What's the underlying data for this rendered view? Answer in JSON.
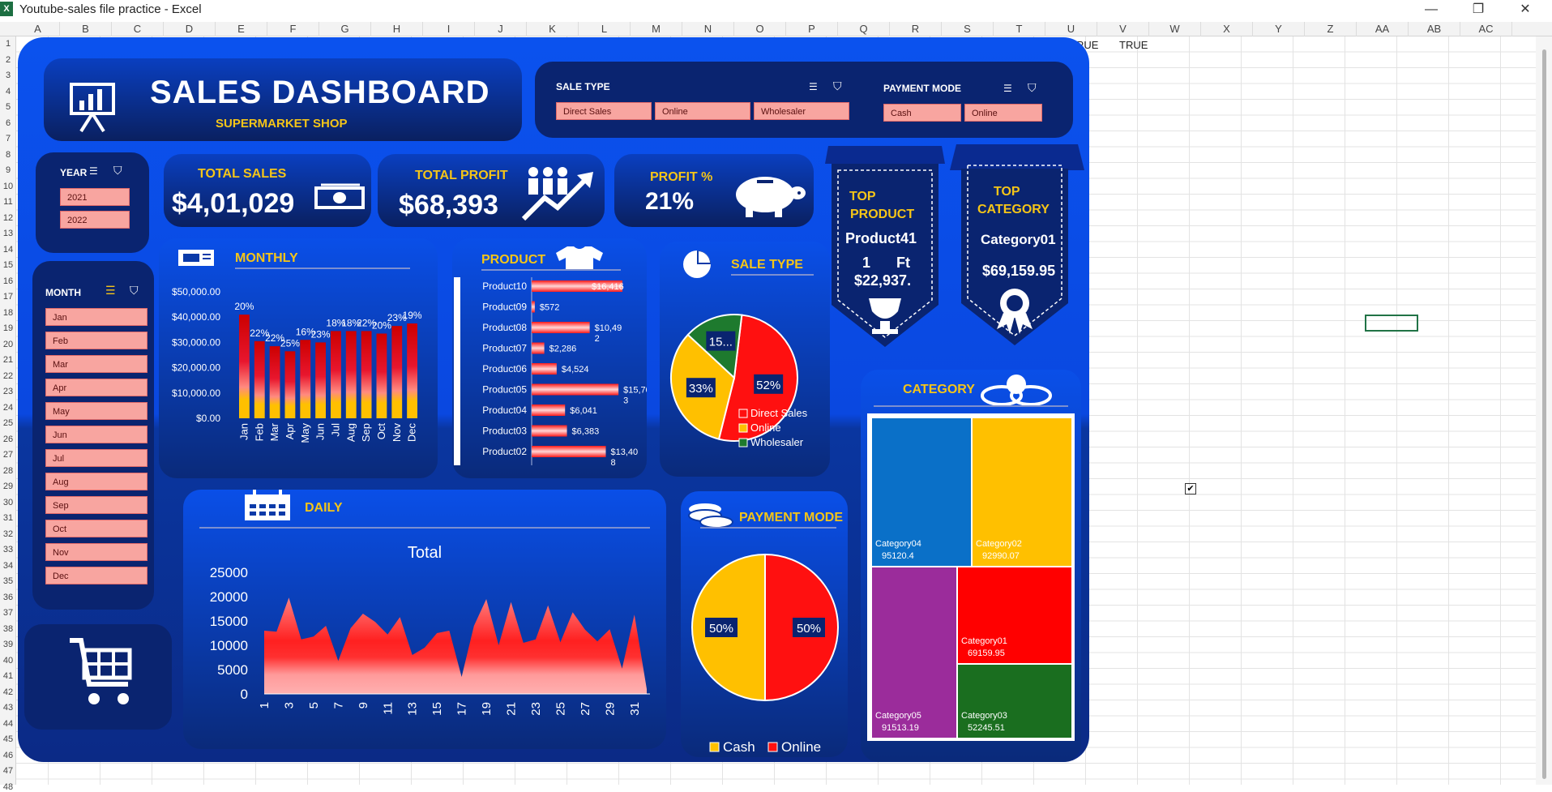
{
  "window": {
    "title": "Youtube-sales file practice - Excel",
    "min": "—",
    "restore": "❐",
    "close": "✕",
    "app_icon": "X"
  },
  "columns": [
    "A",
    "B",
    "C",
    "D",
    "E",
    "F",
    "G",
    "H",
    "I",
    "J",
    "K",
    "L",
    "M",
    "N",
    "O",
    "P",
    "Q",
    "R",
    "S",
    "T",
    "U",
    "V",
    "W",
    "X",
    "Y",
    "Z",
    "AA",
    "AB",
    "AC"
  ],
  "rows": [
    "1",
    "2",
    "3",
    "4",
    "5",
    "6",
    "7",
    "8",
    "9",
    "10",
    "11",
    "12",
    "13",
    "14",
    "15",
    "16",
    "17",
    "18",
    "19",
    "20",
    "21",
    "22",
    "23",
    "24",
    "25",
    "26",
    "27",
    "28",
    "29",
    "30",
    "31",
    "32",
    "33",
    "34",
    "35",
    "36",
    "37",
    "38",
    "39",
    "40",
    "41",
    "42",
    "43",
    "44",
    "45",
    "46",
    "47",
    "48"
  ],
  "cells": {
    "u1": "TRUE",
    "v1": "TRUE",
    "checkbox": "✔"
  },
  "header": {
    "title": "SALES DASHBOARD",
    "subtitle": "SUPERMARKET SHOP"
  },
  "sale_type_slicer": {
    "label": "SALE TYPE",
    "options": [
      "Direct Sales",
      "Online",
      "Wholesaler"
    ]
  },
  "payment_slicer": {
    "label": "PAYMENT MODE",
    "options": [
      "Cash",
      "Online"
    ]
  },
  "year_slicer": {
    "label": "YEAR",
    "options": [
      "2021",
      "2022"
    ]
  },
  "month_slicer": {
    "label": "MONTH",
    "options": [
      "Jan",
      "Feb",
      "Mar",
      "Apr",
      "May",
      "Jun",
      "Jul",
      "Aug",
      "Sep",
      "Oct",
      "Nov",
      "Dec"
    ]
  },
  "kpis": {
    "sales": {
      "title": "TOTAL SALES",
      "value": "$4,01,029"
    },
    "profit": {
      "title": "TOTAL PROFIT",
      "value": "$68,393"
    },
    "profit_pct": {
      "title": "PROFIT %",
      "value": "21%"
    }
  },
  "top_product": {
    "title1": "TOP",
    "title2": "PRODUCT",
    "name": "Product41",
    "line1a": "1",
    "line1b": "Ft",
    "amount": "$22,937."
  },
  "top_category": {
    "title1": "TOP",
    "title2": "CATEGORY",
    "name": "Category01",
    "amount": "$69,159.95"
  },
  "monthly": {
    "title": "MONTHLY"
  },
  "product": {
    "title": "PRODUCT"
  },
  "sale_type": {
    "title": "SALE TYPE"
  },
  "category": {
    "title": "CATEGORY"
  },
  "daily": {
    "title": "DAILY"
  },
  "payment": {
    "title": "PAYMENT MODE"
  },
  "chart_data": [
    {
      "type": "bar",
      "id": "monthly",
      "categories": [
        "Jan",
        "Feb",
        "Mar",
        "Apr",
        "May",
        "Jun",
        "Jul",
        "Aug",
        "Sep",
        "Oct",
        "Nov",
        "Dec"
      ],
      "values": [
        41000,
        30500,
        28500,
        26500,
        31000,
        30000,
        34500,
        34500,
        34500,
        33500,
        36500,
        37500
      ],
      "labels": [
        "20%",
        "22%",
        "22%",
        "25%",
        "16%",
        "23%",
        "18%",
        "18%",
        "22%",
        "20%",
        "23%",
        "19%"
      ],
      "yticks": [
        "$50,000.00",
        "$40,000.00",
        "$30,000.00",
        "$20,000.00",
        "$10,000.00",
        "$0.00"
      ],
      "ylim": [
        0,
        50000
      ]
    },
    {
      "type": "bar",
      "id": "product",
      "orientation": "horizontal",
      "categories": [
        "Product10",
        "Product09",
        "Product08",
        "Product07",
        "Product06",
        "Product05",
        "Product04",
        "Product03",
        "Product02"
      ],
      "values": [
        16416,
        572,
        10492,
        2286,
        4524,
        15703,
        6041,
        6383,
        13408
      ],
      "labels": [
        "$16,416",
        "$572",
        "$10,49\n2",
        "$2,286",
        "$4,524",
        "$15,70\n3",
        "$6,041",
        "$6,383",
        "$13,40\n8"
      ]
    },
    {
      "type": "pie",
      "id": "sale_type",
      "categories": [
        "Direct Sales",
        "Online",
        "Wholesaler"
      ],
      "values": [
        52,
        33,
        15
      ],
      "labels": [
        "52%",
        "33%",
        "15..."
      ],
      "colors": [
        "#ff1010",
        "#ffc000",
        "#1e7a2e"
      ]
    },
    {
      "type": "area",
      "id": "daily",
      "title": "Total",
      "x": [
        1,
        2,
        3,
        4,
        5,
        6,
        7,
        8,
        9,
        10,
        11,
        12,
        13,
        14,
        15,
        16,
        17,
        18,
        19,
        20,
        21,
        22,
        23,
        24,
        25,
        26,
        27,
        28,
        29,
        30,
        31
      ],
      "values": [
        13000,
        12800,
        19800,
        11200,
        11800,
        14000,
        6800,
        13500,
        16500,
        14800,
        12200,
        15800,
        8000,
        9500,
        12500,
        13000,
        3500,
        14000,
        19500,
        10000,
        18900,
        10500,
        11200,
        18200,
        10600,
        16800,
        13200,
        10800,
        13300,
        5200,
        16300,
        1000
      ],
      "xticks": [
        "1",
        "3",
        "5",
        "7",
        "9",
        "11",
        "13",
        "15",
        "17",
        "19",
        "21",
        "23",
        "25",
        "27",
        "29",
        "31"
      ],
      "yticks": [
        "25000",
        "20000",
        "15000",
        "10000",
        "5000",
        "0"
      ],
      "ylim": [
        0,
        25000
      ]
    },
    {
      "type": "pie",
      "id": "payment",
      "categories": [
        "Cash",
        "Online"
      ],
      "values": [
        50,
        50
      ],
      "labels": [
        "50%",
        "50%"
      ],
      "colors": [
        "#ffc000",
        "#ff1010"
      ]
    },
    {
      "type": "heatmap",
      "id": "category_treemap",
      "categories": [
        "Category04",
        "Category02",
        "Category05",
        "Category01",
        "Category03"
      ],
      "values": [
        "95120.4",
        "92990.07",
        "91513.19",
        "69159.95",
        "52245.51"
      ],
      "colors": [
        "#0a70c8",
        "#ffc000",
        "#9b2c9b",
        "#ff0000",
        "#1a6e1f"
      ]
    }
  ]
}
